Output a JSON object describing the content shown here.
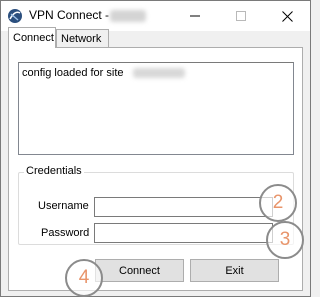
{
  "window": {
    "title": "VPN Connect -",
    "controls": {
      "minimize": "—",
      "maximize": "☐",
      "close": "✕"
    }
  },
  "tabs": [
    {
      "label": "Connect",
      "selected": true
    },
    {
      "label": "Network",
      "selected": false
    }
  ],
  "log": {
    "lines": [
      "config loaded for site"
    ]
  },
  "credentials": {
    "group_label": "Credentials",
    "username_label": "Username",
    "username_value": "",
    "password_label": "Password",
    "password_value": ""
  },
  "buttons": {
    "connect_label": "Connect",
    "exit_label": "Exit"
  },
  "step_markers": [
    "2",
    "3",
    "4"
  ],
  "colors": {
    "marker_number": "#e8946a",
    "marker_ring": "#8b8b8b",
    "window_bg": "#f0f0f0"
  }
}
